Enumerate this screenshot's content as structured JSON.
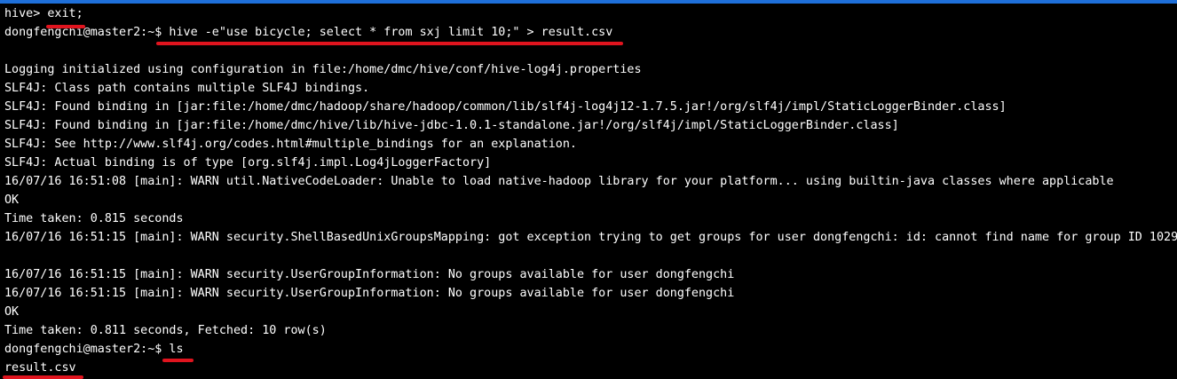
{
  "accent_color": "#1e6fd9",
  "annotation_color": "#e0141e",
  "terminal": {
    "lines": [
      "hive> exit;",
      "dongfengchi@master2:~$ hive -e\"use bicycle; select * from sxj limit 10;\" > result.csv",
      "",
      "Logging initialized using configuration in file:/home/dmc/hive/conf/hive-log4j.properties",
      "SLF4J: Class path contains multiple SLF4J bindings.",
      "SLF4J: Found binding in [jar:file:/home/dmc/hadoop/share/hadoop/common/lib/slf4j-log4j12-1.7.5.jar!/org/slf4j/impl/StaticLoggerBinder.class]",
      "SLF4J: Found binding in [jar:file:/home/dmc/hive/lib/hive-jdbc-1.0.1-standalone.jar!/org/slf4j/impl/StaticLoggerBinder.class]",
      "SLF4J: See http://www.slf4j.org/codes.html#multiple_bindings for an explanation.",
      "SLF4J: Actual binding is of type [org.slf4j.impl.Log4jLoggerFactory]",
      "16/07/16 16:51:08 [main]: WARN util.NativeCodeLoader: Unable to load native-hadoop library for your platform... using builtin-java classes where applicable",
      "OK",
      "Time taken: 0.815 seconds",
      "16/07/16 16:51:15 [main]: WARN security.ShellBasedUnixGroupsMapping: got exception trying to get groups for user dongfengchi: id: cannot find name for group ID 1029",
      "",
      "16/07/16 16:51:15 [main]: WARN security.UserGroupInformation: No groups available for user dongfengchi",
      "16/07/16 16:51:15 [main]: WARN security.UserGroupInformation: No groups available for user dongfengchi",
      "OK",
      "Time taken: 0.811 seconds, Fetched: 10 row(s)",
      "dongfengchi@master2:~$ ls",
      "result.csv"
    ]
  }
}
